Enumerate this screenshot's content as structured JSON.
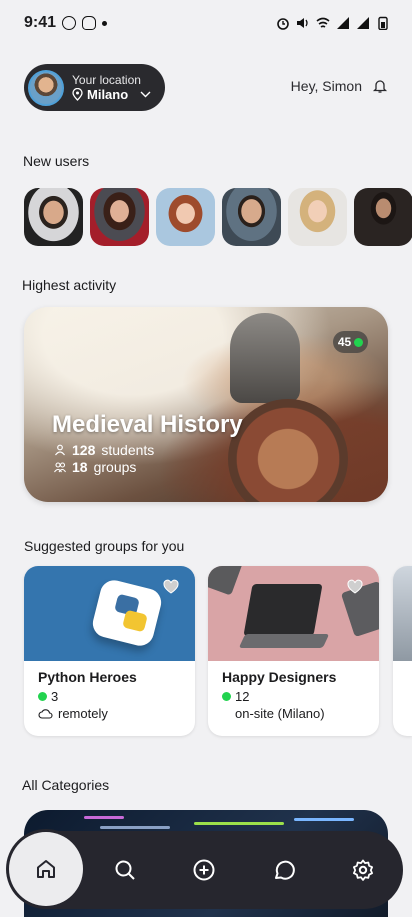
{
  "status": {
    "time": "9:41"
  },
  "location": {
    "label": "Your location",
    "city": "Milano"
  },
  "greeting": "Hey, Simon",
  "sections": {
    "new_users": "New users",
    "highest_activity": "Highest activity",
    "suggested": "Suggested groups for you",
    "categories": "All Categories"
  },
  "activity": {
    "title": "Medieval History",
    "students_count": "128",
    "students_label": "students",
    "groups_count": "18",
    "groups_label": "groups",
    "online_count": "45"
  },
  "groups": [
    {
      "title": "Python Heroes",
      "members": "3",
      "place": "remotely"
    },
    {
      "title": "Happy Designers",
      "members": "12",
      "place": "on-site (Milano)"
    }
  ],
  "colors": {
    "accent_dark": "#26262e",
    "online": "#22d34f",
    "background": "#f1f1f3"
  },
  "nav": [
    "home-icon",
    "search-icon",
    "add-icon",
    "chat-icon",
    "settings-icon"
  ]
}
